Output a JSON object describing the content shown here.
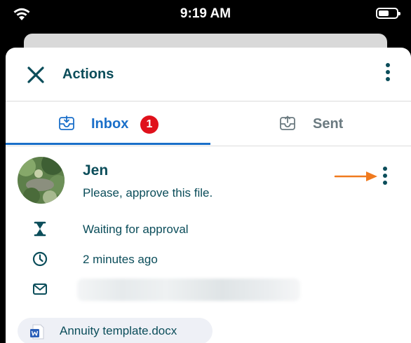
{
  "status_bar": {
    "time": "9:19 AM"
  },
  "header": {
    "title": "Actions"
  },
  "tabs": [
    {
      "label": "Inbox",
      "badge": "1",
      "selected": true
    },
    {
      "label": "Sent",
      "selected": false
    }
  ],
  "item": {
    "sender": "Jen",
    "message": "Please, approve this file.",
    "status": "Waiting for approval",
    "time": "2 minutes ago",
    "attachment": "Annuity template.docx"
  },
  "colors": {
    "primary_text": "#0b4d5a",
    "accent_blue": "#1a6fc9",
    "badge_red": "#e0111b",
    "arrow_orange": "#f07a1e"
  },
  "icons": [
    "wifi-icon",
    "battery-icon",
    "close-icon",
    "more-vertical-icon",
    "inbox-tray-icon",
    "sent-tray-icon",
    "hourglass-icon",
    "clock-icon",
    "envelope-icon",
    "word-doc-icon",
    "arrow-right-icon"
  ]
}
